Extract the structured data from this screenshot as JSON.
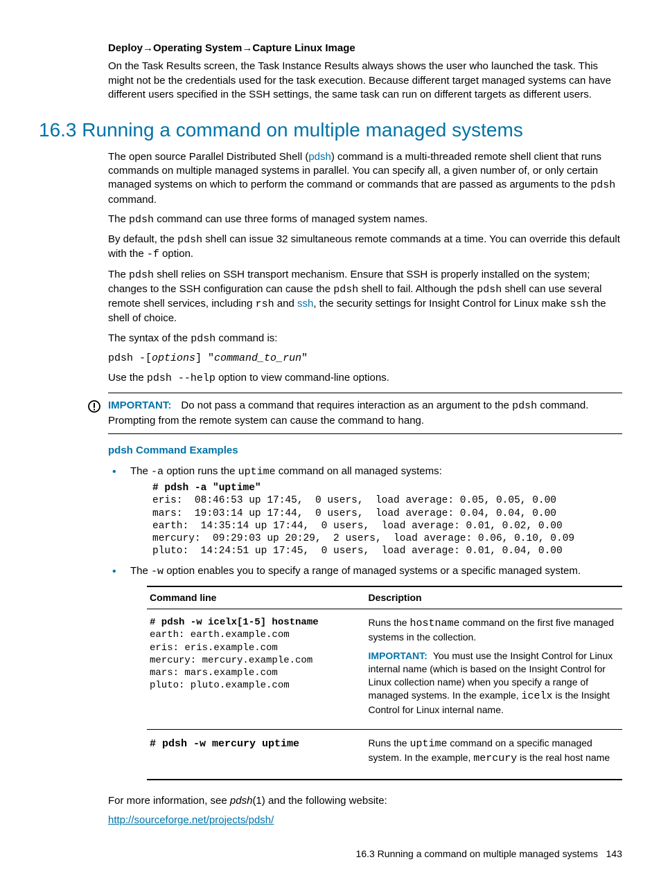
{
  "breadcrumb": "Deploy→Operating System→Capture Linux Image",
  "intro_para": "On the Task Results screen, the Task Instance Results always shows the user who launched the task. This might not be the credentials used for the task execution. Because different target managed systems can have different users specified in the SSH settings, the same task can run on different targets as different users.",
  "section_heading": "16.3 Running a command on multiple managed systems",
  "p1_a": "The open source Parallel Distributed Shell (",
  "p1_link": "pdsh",
  "p1_b": ") command is a multi-threaded remote shell client that runs commands on multiple managed systems in parallel. You can specify all, a given number of, or only certain managed systems on which to perform the command or commands that are passed as arguments to the ",
  "p1_c": " command.",
  "p2_a": "The ",
  "p2_b": " command can use three forms of managed system names.",
  "p3_a": "By default, the ",
  "p3_b": " shell can issue 32 simultaneous remote commands at a time. You can override this default with the ",
  "p3_c": " option.",
  "p4_a": "The ",
  "p4_b": " shell relies on SSH transport mechanism. Ensure that SSH is properly installed on the system; changes to the SSH configuration can cause the ",
  "p4_c": " shell to fail. Although the ",
  "p4_d": " shell can use several remote shell services, including ",
  "p4_e": " and ",
  "p4_f": ", the security settings for Insight Control for Linux make ",
  "p4_g": " the shell of choice.",
  "p5_a": "The syntax of the ",
  "p5_b": " command is:",
  "syntax_cmd": "pdsh -[",
  "syntax_opts": "options",
  "syntax_mid": "] \"",
  "syntax_run": "command_to_run",
  "syntax_end": "\"",
  "p6_a": "Use the ",
  "p6_b": " option to view command-line options.",
  "code_pdsh": "pdsh",
  "code_dashf": "-f",
  "code_rsh": "rsh",
  "code_ssh": "ssh",
  "code_help": "pdsh --help",
  "important_label": "IMPORTANT:",
  "important_a": "Do not pass a command that requires interaction as an argument to the ",
  "important_b": " command. Prompting from the remote system can cause the command to hang.",
  "examples_heading": "pdsh Command Examples",
  "li1_a": "The ",
  "li1_b": " option runs the ",
  "li1_c": " command on all managed systems:",
  "code_dasha": "-a",
  "code_uptime": "uptime",
  "example1_cmd": "# pdsh -a \"uptime\"",
  "example1_out": "eris:  08:46:53 up 17:45,  0 users,  load average: 0.05, 0.05, 0.00\nmars:  19:03:14 up 17:44,  0 users,  load average: 0.04, 0.04, 0.00\nearth:  14:35:14 up 17:44,  0 users,  load average: 0.01, 0.02, 0.00\nmercury:  09:29:03 up 20:29,  2 users,  load average: 0.06, 0.10, 0.09\npluto:  14:24:51 up 17:45,  0 users,  load average: 0.01, 0.04, 0.00",
  "li2_a": "The ",
  "li2_b": " option enables you to specify a range of managed systems or a specific managed system.",
  "code_dashw": "-w",
  "th_cmd": "Command line",
  "th_desc": "Description",
  "row1_cmd_bold": "# pdsh -w icelx[1-5] hostname",
  "row1_cmd_out": "earth: earth.example.com\neris: eris.example.com\nmercury: mercury.example.com\nmars: mars.example.com\npluto: pluto.example.com",
  "row1_desc1_a": "Runs the ",
  "row1_desc1_b": " command on the first five managed systems in the collection.",
  "code_hostname": "hostname",
  "row1_desc2_a": "You must use the Insight Control for Linux internal name (which is based on the Insight Control for Linux collection name) when you specify a range of managed systems. In the example, ",
  "row1_desc2_b": " is the Insight Control for Linux internal name.",
  "code_icelx": "icelx",
  "row2_cmd": "# pdsh -w mercury uptime",
  "row2_desc_a": "Runs the ",
  "row2_desc_b": " command on a specific managed system. In the example, ",
  "row2_desc_c": " is the real host name",
  "code_mercury": "mercury",
  "more_info_a": "For more information, see ",
  "more_info_b": "(1) and the following website:",
  "ital_pdsh": "pdsh",
  "url": "http://sourceforge.net/projects/pdsh/",
  "footer_text": "16.3 Running a command on multiple managed systems",
  "footer_page": "143"
}
